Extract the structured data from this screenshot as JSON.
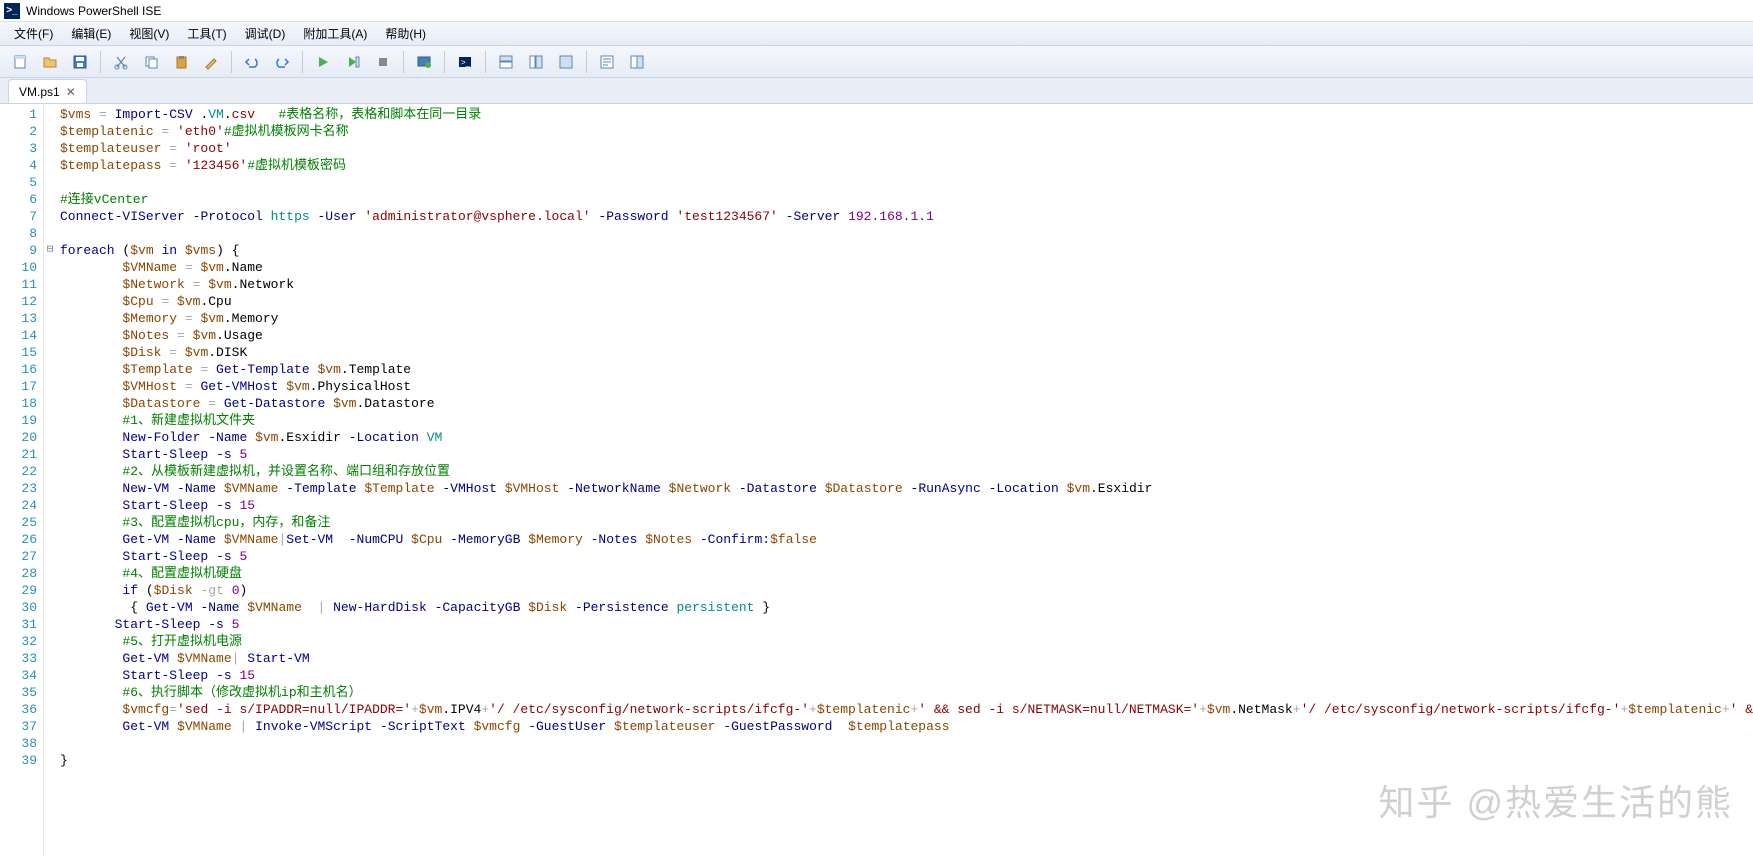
{
  "title": "Windows PowerShell ISE",
  "menubar": [
    "文件(F)",
    "编辑(E)",
    "视图(V)",
    "工具(T)",
    "调试(D)",
    "附加工具(A)",
    "帮助(H)"
  ],
  "tab": {
    "name": "VM.ps1",
    "close": "✕"
  },
  "watermark": "知乎 @热爱生活的熊",
  "lines": [
    {
      "n": 1,
      "seg": [
        [
          "v",
          "$vms"
        ],
        [
          "op",
          " = "
        ],
        [
          "kw",
          "Import-CSV"
        ],
        [
          "mb",
          " ."
        ],
        [
          "ty",
          "VM"
        ],
        [
          "mb",
          "."
        ],
        [
          "st",
          "csv"
        ],
        [
          "mb",
          "   "
        ],
        [
          "cm",
          "#表格名称，表格和脚本在同一目录"
        ]
      ]
    },
    {
      "n": 2,
      "seg": [
        [
          "v",
          "$templatenic"
        ],
        [
          "op",
          " = "
        ],
        [
          "st",
          "'eth0'"
        ],
        [
          "cm",
          "#虚拟机模板网卡名称"
        ]
      ]
    },
    {
      "n": 3,
      "seg": [
        [
          "v",
          "$templateuser"
        ],
        [
          "op",
          " = "
        ],
        [
          "st",
          "'root'"
        ]
      ]
    },
    {
      "n": 4,
      "seg": [
        [
          "v",
          "$templatepass"
        ],
        [
          "op",
          " = "
        ],
        [
          "st",
          "'123456'"
        ],
        [
          "cm",
          "#虚拟机模板密码"
        ]
      ]
    },
    {
      "n": 5,
      "seg": []
    },
    {
      "n": 6,
      "seg": [
        [
          "cm",
          "#连接vCenter"
        ]
      ]
    },
    {
      "n": 7,
      "seg": [
        [
          "kw",
          "Connect-VIServer"
        ],
        [
          "mb",
          " "
        ],
        [
          "pm",
          "-Protocol"
        ],
        [
          "mb",
          " "
        ],
        [
          "ty",
          "https"
        ],
        [
          "mb",
          " "
        ],
        [
          "pm",
          "-User"
        ],
        [
          "mb",
          " "
        ],
        [
          "st",
          "'administrator@vsphere.local'"
        ],
        [
          "mb",
          " "
        ],
        [
          "pm",
          "-Password"
        ],
        [
          "mb",
          " "
        ],
        [
          "st",
          "'test1234567'"
        ],
        [
          "mb",
          " "
        ],
        [
          "pm",
          "-Server"
        ],
        [
          "mb",
          " "
        ],
        [
          "nm",
          "192.168.1.1"
        ]
      ]
    },
    {
      "n": 8,
      "seg": []
    },
    {
      "n": 9,
      "fold": "⊟",
      "seg": [
        [
          "kw",
          "foreach"
        ],
        [
          "mb",
          " ("
        ],
        [
          "v",
          "$vm"
        ],
        [
          "mb",
          " "
        ],
        [
          "kw",
          "in"
        ],
        [
          "mb",
          " "
        ],
        [
          "v",
          "$vms"
        ],
        [
          "mb",
          ") {"
        ]
      ]
    },
    {
      "n": 10,
      "seg": [
        [
          "mb",
          "        "
        ],
        [
          "v",
          "$VMName"
        ],
        [
          "op",
          " = "
        ],
        [
          "v",
          "$vm"
        ],
        [
          "mb",
          ".Name"
        ]
      ]
    },
    {
      "n": 11,
      "seg": [
        [
          "mb",
          "        "
        ],
        [
          "v",
          "$Network"
        ],
        [
          "op",
          " = "
        ],
        [
          "v",
          "$vm"
        ],
        [
          "mb",
          ".Network"
        ]
      ]
    },
    {
      "n": 12,
      "seg": [
        [
          "mb",
          "        "
        ],
        [
          "v",
          "$Cpu"
        ],
        [
          "op",
          " = "
        ],
        [
          "v",
          "$vm"
        ],
        [
          "mb",
          ".Cpu"
        ]
      ]
    },
    {
      "n": 13,
      "seg": [
        [
          "mb",
          "        "
        ],
        [
          "v",
          "$Memory"
        ],
        [
          "op",
          " = "
        ],
        [
          "v",
          "$vm"
        ],
        [
          "mb",
          ".Memory"
        ]
      ]
    },
    {
      "n": 14,
      "seg": [
        [
          "mb",
          "        "
        ],
        [
          "v",
          "$Notes"
        ],
        [
          "op",
          " = "
        ],
        [
          "v",
          "$vm"
        ],
        [
          "mb",
          ".Usage"
        ]
      ]
    },
    {
      "n": 15,
      "seg": [
        [
          "mb",
          "        "
        ],
        [
          "v",
          "$Disk"
        ],
        [
          "op",
          " = "
        ],
        [
          "v",
          "$vm"
        ],
        [
          "mb",
          ".DISK"
        ]
      ]
    },
    {
      "n": 16,
      "seg": [
        [
          "mb",
          "        "
        ],
        [
          "v",
          "$Template"
        ],
        [
          "op",
          " = "
        ],
        [
          "kw",
          "Get-Template"
        ],
        [
          "mb",
          " "
        ],
        [
          "v",
          "$vm"
        ],
        [
          "mb",
          ".Template"
        ]
      ]
    },
    {
      "n": 17,
      "seg": [
        [
          "mb",
          "        "
        ],
        [
          "v",
          "$VMHost"
        ],
        [
          "op",
          " = "
        ],
        [
          "kw",
          "Get-VMHost"
        ],
        [
          "mb",
          " "
        ],
        [
          "v",
          "$vm"
        ],
        [
          "mb",
          ".PhysicalHost"
        ]
      ]
    },
    {
      "n": 18,
      "seg": [
        [
          "mb",
          "        "
        ],
        [
          "v",
          "$Datastore"
        ],
        [
          "op",
          " = "
        ],
        [
          "kw",
          "Get-Datastore"
        ],
        [
          "mb",
          " "
        ],
        [
          "v",
          "$vm"
        ],
        [
          "mb",
          ".Datastore"
        ]
      ]
    },
    {
      "n": 19,
      "seg": [
        [
          "mb",
          "        "
        ],
        [
          "cm",
          "#1、新建虚拟机文件夹"
        ]
      ]
    },
    {
      "n": 20,
      "seg": [
        [
          "mb",
          "        "
        ],
        [
          "kw",
          "New-Folder"
        ],
        [
          "mb",
          " "
        ],
        [
          "pm",
          "-Name"
        ],
        [
          "mb",
          " "
        ],
        [
          "v",
          "$vm"
        ],
        [
          "mb",
          ".Esxidir "
        ],
        [
          "pm",
          "-Location"
        ],
        [
          "mb",
          " "
        ],
        [
          "ty",
          "VM"
        ]
      ]
    },
    {
      "n": 21,
      "seg": [
        [
          "mb",
          "        "
        ],
        [
          "kw",
          "Start-Sleep"
        ],
        [
          "mb",
          " "
        ],
        [
          "pm",
          "-s"
        ],
        [
          "mb",
          " "
        ],
        [
          "nm",
          "5"
        ]
      ]
    },
    {
      "n": 22,
      "seg": [
        [
          "mb",
          "        "
        ],
        [
          "cm",
          "#2、从模板新建虚拟机，并设置名称、端口组和存放位置"
        ]
      ]
    },
    {
      "n": 23,
      "seg": [
        [
          "mb",
          "        "
        ],
        [
          "kw",
          "New-VM"
        ],
        [
          "mb",
          " "
        ],
        [
          "pm",
          "-Name"
        ],
        [
          "mb",
          " "
        ],
        [
          "v",
          "$VMName"
        ],
        [
          "mb",
          " "
        ],
        [
          "pm",
          "-Template"
        ],
        [
          "mb",
          " "
        ],
        [
          "v",
          "$Template"
        ],
        [
          "mb",
          " "
        ],
        [
          "pm",
          "-VMHost"
        ],
        [
          "mb",
          " "
        ],
        [
          "v",
          "$VMHost"
        ],
        [
          "mb",
          " "
        ],
        [
          "pm",
          "-NetworkName"
        ],
        [
          "mb",
          " "
        ],
        [
          "v",
          "$Network"
        ],
        [
          "mb",
          " "
        ],
        [
          "pm",
          "-Datastore"
        ],
        [
          "mb",
          " "
        ],
        [
          "v",
          "$Datastore"
        ],
        [
          "mb",
          " "
        ],
        [
          "pm",
          "-RunAsync"
        ],
        [
          "mb",
          " "
        ],
        [
          "pm",
          "-Location"
        ],
        [
          "mb",
          " "
        ],
        [
          "v",
          "$vm"
        ],
        [
          "mb",
          ".Esxidir"
        ]
      ]
    },
    {
      "n": 24,
      "seg": [
        [
          "mb",
          "        "
        ],
        [
          "kw",
          "Start-Sleep"
        ],
        [
          "mb",
          " "
        ],
        [
          "pm",
          "-s"
        ],
        [
          "mb",
          " "
        ],
        [
          "nm",
          "15"
        ]
      ]
    },
    {
      "n": 25,
      "seg": [
        [
          "mb",
          "        "
        ],
        [
          "cm",
          "#3、配置虚拟机cpu，内存，和备注"
        ]
      ]
    },
    {
      "n": 26,
      "seg": [
        [
          "mb",
          "        "
        ],
        [
          "kw",
          "Get-VM"
        ],
        [
          "mb",
          " "
        ],
        [
          "pm",
          "-Name"
        ],
        [
          "mb",
          " "
        ],
        [
          "v",
          "$VMName"
        ],
        [
          "op",
          "|"
        ],
        [
          "kw",
          "Set-VM"
        ],
        [
          "mb",
          "  "
        ],
        [
          "pm",
          "-NumCPU"
        ],
        [
          "mb",
          " "
        ],
        [
          "v",
          "$Cpu"
        ],
        [
          "mb",
          " "
        ],
        [
          "pm",
          "-MemoryGB"
        ],
        [
          "mb",
          " "
        ],
        [
          "v",
          "$Memory"
        ],
        [
          "mb",
          " "
        ],
        [
          "pm",
          "-Notes"
        ],
        [
          "mb",
          " "
        ],
        [
          "v",
          "$Notes"
        ],
        [
          "mb",
          " "
        ],
        [
          "pm",
          "-Confirm:"
        ],
        [
          "v",
          "$false"
        ]
      ]
    },
    {
      "n": 27,
      "seg": [
        [
          "mb",
          "        "
        ],
        [
          "kw",
          "Start-Sleep"
        ],
        [
          "mb",
          " "
        ],
        [
          "pm",
          "-s"
        ],
        [
          "mb",
          " "
        ],
        [
          "nm",
          "5"
        ]
      ]
    },
    {
      "n": 28,
      "seg": [
        [
          "mb",
          "        "
        ],
        [
          "cm",
          "#4、配置虚拟机硬盘"
        ]
      ]
    },
    {
      "n": 29,
      "seg": [
        [
          "mb",
          "        "
        ],
        [
          "kw",
          "if"
        ],
        [
          "mb",
          " ("
        ],
        [
          "v",
          "$Disk"
        ],
        [
          "mb",
          " "
        ],
        [
          "op",
          "-gt"
        ],
        [
          "mb",
          " "
        ],
        [
          "nm",
          "0"
        ],
        [
          "mb",
          ")"
        ]
      ]
    },
    {
      "n": 30,
      "seg": [
        [
          "mb",
          "         { "
        ],
        [
          "kw",
          "Get-VM"
        ],
        [
          "mb",
          " "
        ],
        [
          "pm",
          "-Name"
        ],
        [
          "mb",
          " "
        ],
        [
          "v",
          "$VMName"
        ],
        [
          "mb",
          "  "
        ],
        [
          "op",
          "|"
        ],
        [
          "mb",
          " "
        ],
        [
          "kw",
          "New-HardDisk"
        ],
        [
          "mb",
          " "
        ],
        [
          "pm",
          "-CapacityGB"
        ],
        [
          "mb",
          " "
        ],
        [
          "v",
          "$Disk"
        ],
        [
          "mb",
          " "
        ],
        [
          "pm",
          "-Persistence"
        ],
        [
          "mb",
          " "
        ],
        [
          "ty",
          "persistent"
        ],
        [
          "mb",
          " }"
        ]
      ]
    },
    {
      "n": 31,
      "seg": [
        [
          "mb",
          "       "
        ],
        [
          "kw",
          "Start-Sleep"
        ],
        [
          "mb",
          " "
        ],
        [
          "pm",
          "-s"
        ],
        [
          "mb",
          " "
        ],
        [
          "nm",
          "5"
        ]
      ]
    },
    {
      "n": 32,
      "seg": [
        [
          "mb",
          "        "
        ],
        [
          "cm",
          "#5、打开虚拟机电源"
        ]
      ]
    },
    {
      "n": 33,
      "seg": [
        [
          "mb",
          "        "
        ],
        [
          "kw",
          "Get-VM"
        ],
        [
          "mb",
          " "
        ],
        [
          "v",
          "$VMName"
        ],
        [
          "op",
          "|"
        ],
        [
          "mb",
          " "
        ],
        [
          "kw",
          "Start-VM"
        ]
      ]
    },
    {
      "n": 34,
      "seg": [
        [
          "mb",
          "        "
        ],
        [
          "kw",
          "Start-Sleep"
        ],
        [
          "mb",
          " "
        ],
        [
          "pm",
          "-s"
        ],
        [
          "mb",
          " "
        ],
        [
          "nm",
          "15"
        ]
      ]
    },
    {
      "n": 35,
      "seg": [
        [
          "mb",
          "        "
        ],
        [
          "cm",
          "#6、执行脚本（修改虚拟机ip和主机名）"
        ]
      ]
    },
    {
      "n": 36,
      "seg": [
        [
          "mb",
          "        "
        ],
        [
          "v",
          "$vmcfg"
        ],
        [
          "op",
          "="
        ],
        [
          "st",
          "'sed -i s/IPADDR=null/IPADDR='"
        ],
        [
          "op",
          "+"
        ],
        [
          "v",
          "$vm"
        ],
        [
          "mb",
          ".IPV4"
        ],
        [
          "op",
          "+"
        ],
        [
          "st",
          "'/ /etc/sysconfig/network-scripts/ifcfg-'"
        ],
        [
          "op",
          "+"
        ],
        [
          "v",
          "$templatenic"
        ],
        [
          "op",
          "+"
        ],
        [
          "st",
          "' && sed -i s/NETMASK=null/NETMASK='"
        ],
        [
          "op",
          "+"
        ],
        [
          "v",
          "$vm"
        ],
        [
          "mb",
          ".NetMask"
        ],
        [
          "op",
          "+"
        ],
        [
          "st",
          "'/ /etc/sysconfig/network-scripts/ifcfg-'"
        ],
        [
          "op",
          "+"
        ],
        [
          "v",
          "$templatenic"
        ],
        [
          "op",
          "+"
        ],
        [
          "st",
          "' && sed -i"
        ]
      ]
    },
    {
      "n": 37,
      "seg": [
        [
          "mb",
          "        "
        ],
        [
          "kw",
          "Get-VM"
        ],
        [
          "mb",
          " "
        ],
        [
          "v",
          "$VMName"
        ],
        [
          "mb",
          " "
        ],
        [
          "op",
          "|"
        ],
        [
          "mb",
          " "
        ],
        [
          "kw",
          "Invoke-VMScript"
        ],
        [
          "mb",
          " "
        ],
        [
          "pm",
          "-ScriptText"
        ],
        [
          "mb",
          " "
        ],
        [
          "v",
          "$vmcfg"
        ],
        [
          "mb",
          " "
        ],
        [
          "pm",
          "-GuestUser"
        ],
        [
          "mb",
          " "
        ],
        [
          "v",
          "$templateuser"
        ],
        [
          "mb",
          " "
        ],
        [
          "pm",
          "-GuestPassword"
        ],
        [
          "mb",
          "  "
        ],
        [
          "v",
          "$templatepass"
        ]
      ]
    },
    {
      "n": 38,
      "seg": []
    },
    {
      "n": 39,
      "seg": [
        [
          "mb",
          "}"
        ]
      ]
    }
  ]
}
